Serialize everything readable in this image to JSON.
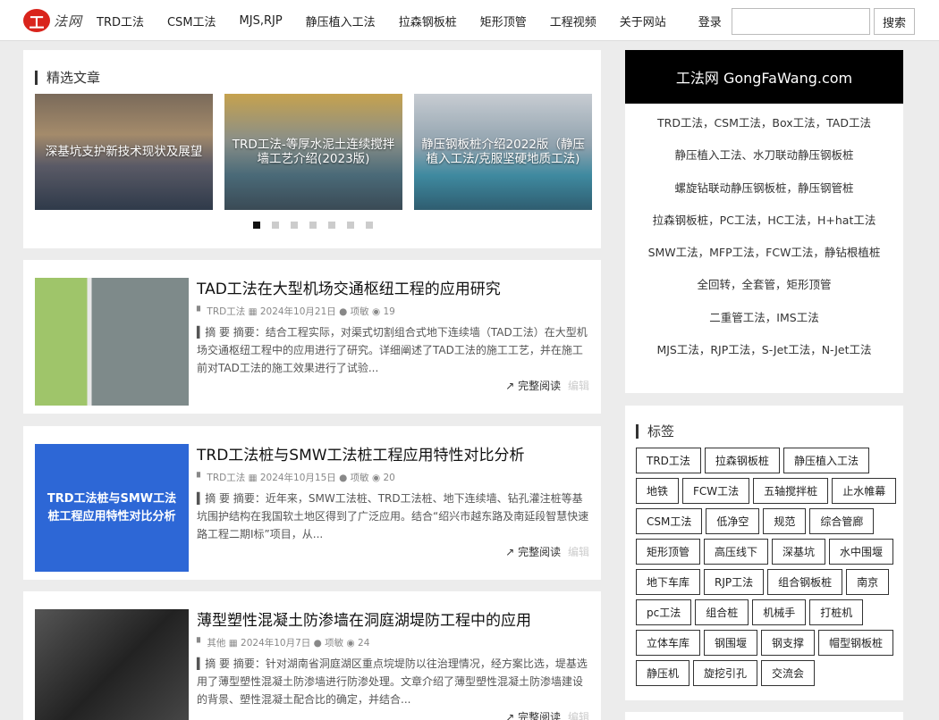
{
  "header": {
    "logo_mark": "工",
    "logo_text": "法网",
    "nav": [
      "TRD工法",
      "CSM工法",
      "MJS,RJP",
      "静压植入工法",
      "拉森钢板桩",
      "矩形顶管",
      "工程视频",
      "关于网站",
      "登录"
    ],
    "search_placeholder": "",
    "search_button": "搜索"
  },
  "featured": {
    "title": "精选文章",
    "slides": [
      "深基坑支护新技术现状及展望",
      "TRD工法-等厚水泥土连续搅拌墙工艺介绍(2023版)",
      "静压钢板桩介绍2022版（静压植入工法/克服坚硬地质工法)"
    ],
    "dot_count": 7,
    "active_dot": 0
  },
  "articles": [
    {
      "title": "TAD工法在大型机场交通枢纽工程的应用研究",
      "category": "TRD工法",
      "date": "2024年10月21日",
      "author": "项敏",
      "views": "19",
      "excerpt": "▍摘 要 摘要：结合工程实际，对渠式切割组合式地下连续墙（TAD工法）在大型机场交通枢纽工程中的应用进行了研究。详细阐述了TAD工法的施工工艺，并在施工前对TAD工法的施工效果进行了试验...",
      "read_more": "完整阅读",
      "edit": "编辑"
    },
    {
      "title": "TRD工法桩与SMW工法桩工程应用特性对比分析",
      "category": "TRD工法",
      "date": "2024年10月15日",
      "author": "项敏",
      "views": "20",
      "excerpt": "▍摘 要 摘要：近年来，SMW工法桩、TRD工法桩、地下连续墙、钻孔灌注桩等基坑围护结构在我国软土地区得到了广泛应用。结合“绍兴市越东路及南延段智慧快速路工程二期Ⅰ标”项目，从...",
      "thumb_text": "TRD工法桩与SMW工法桩工程应用特性对比分析",
      "read_more": "完整阅读",
      "edit": "编辑"
    },
    {
      "title": "薄型塑性混凝土防渗墙在洞庭湖堤防工程中的应用",
      "category": "其他",
      "date": "2024年10月7日",
      "author": "项敏",
      "views": "24",
      "excerpt": "▍摘 要 摘要：针对湖南省洞庭湖区重点垸堤防以往治理情况，经方案比选，堤基选用了薄型塑性混凝土防渗墙进行防渗处理。文章介绍了薄型塑性混凝土防渗墙建设的背景、塑性混凝土配合比的确定，并结合...",
      "read_more": "完整阅读",
      "edit": "编辑"
    }
  ],
  "sidebar": {
    "site_title": "工法网 GongFaWang.com",
    "site_lines": [
      "TRD工法，CSM工法，Box工法，TAD工法",
      "静压植入工法、水刀联动静压钢板桩",
      "螺旋钻联动静压钢板桩，静压钢管桩",
      "拉森钢板桩，PC工法，HC工法，H+hat工法",
      "SMW工法，MFP工法，FCW工法，静钻根植桩",
      "全回转，全套管，矩形顶管",
      "二重管工法，IMS工法",
      "MJS工法，RJP工法，S-Jet工法，N-Jet工法"
    ],
    "tags_title": "标签",
    "tags": [
      "TRD工法",
      "拉森钢板桩",
      "静压植入工法",
      "地铁",
      "FCW工法",
      "五轴搅拌桩",
      "止水帷幕",
      "CSM工法",
      "低净空",
      "规范",
      "综合管廊",
      "矩形顶管",
      "高压线下",
      "深基坑",
      "水中围堰",
      "地下车库",
      "RJP工法",
      "组合钢板桩",
      "南京",
      "pc工法",
      "组合桩",
      "机械手",
      "打桩机",
      "立体车库",
      "钢围堰",
      "钢支撑",
      "帽型钢板桩",
      "静压机",
      "旋挖引孔",
      "交流会"
    ]
  }
}
